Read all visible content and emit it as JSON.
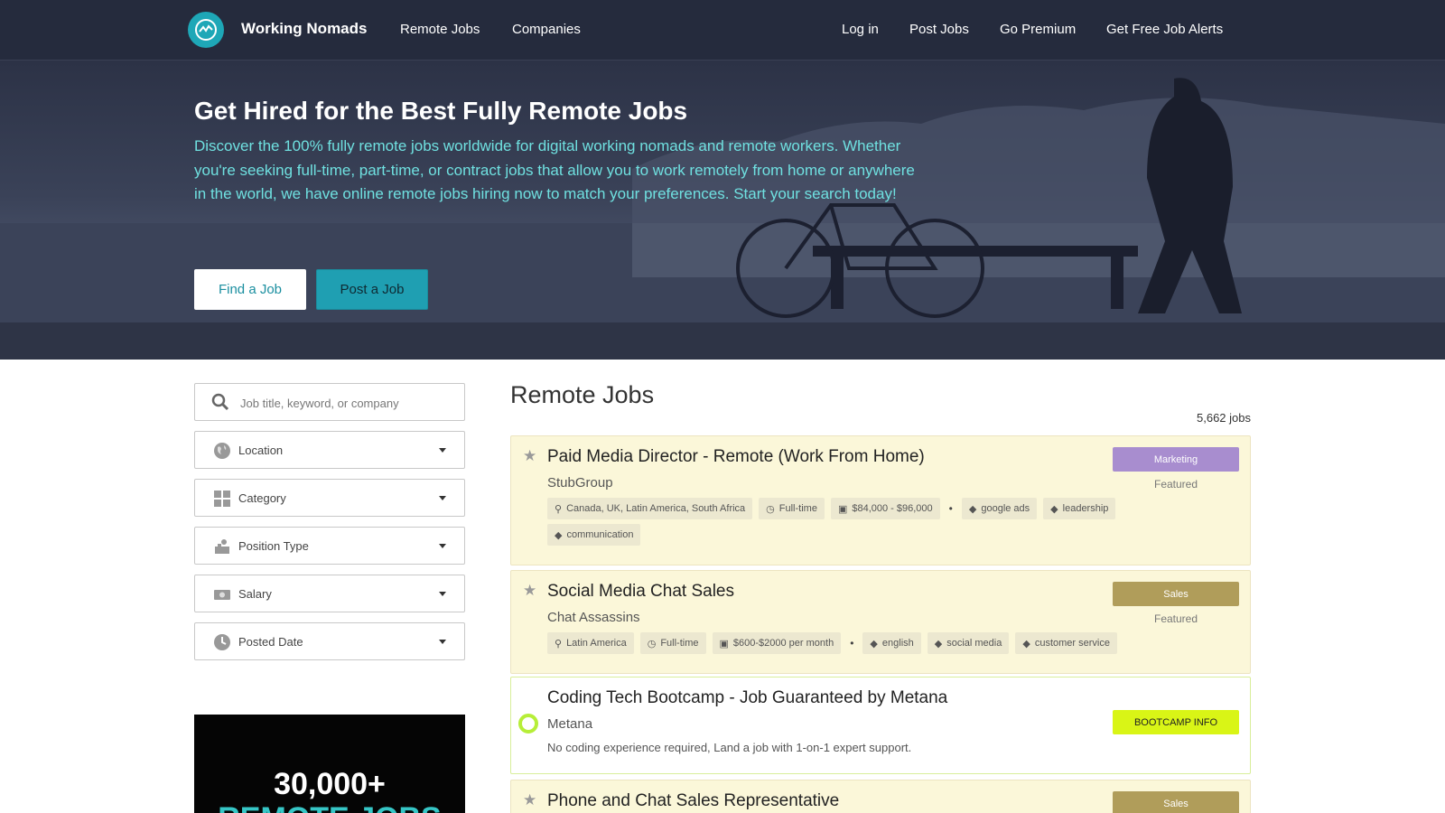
{
  "nav": {
    "brand": "Working Nomads",
    "links_left": [
      "Remote Jobs",
      "Companies"
    ],
    "links_right": [
      "Log in",
      "Post Jobs",
      "Go Premium",
      "Get Free Job Alerts"
    ]
  },
  "hero": {
    "title": "Get Hired for the Best Fully Remote Jobs",
    "description": "Discover the 100% fully remote jobs worldwide for digital working nomads and remote workers. Whether you're seeking full-time, part-time, or contract jobs that allow you to work remotely from home or anywhere in the world, we have online remote jobs hiring now to match your preferences. Start your search today!",
    "find_button": "Find a Job",
    "post_button": "Post a Job"
  },
  "sidebar": {
    "search_placeholder": "Job title, keyword, or company",
    "filters": [
      {
        "label": "Location",
        "icon": "globe-icon"
      },
      {
        "label": "Category",
        "icon": "grid-icon"
      },
      {
        "label": "Position Type",
        "icon": "worker-icon"
      },
      {
        "label": "Salary",
        "icon": "money-icon"
      },
      {
        "label": "Posted Date",
        "icon": "clock-icon"
      }
    ],
    "ad": {
      "line1": "30,000+",
      "line2": "REMOTE JOBS"
    }
  },
  "jobs": {
    "title": "Remote Jobs",
    "count": "5,662 jobs",
    "items": [
      {
        "title": "Paid Media Director - Remote (Work From Home)",
        "company": "StubGroup",
        "location": "Canada, UK, Latin America, South Africa",
        "type": "Full-time",
        "salary": "$84,000 - $96,000",
        "skills": [
          "google ads",
          "leadership",
          "communication"
        ],
        "badge": "Marketing",
        "badge_color": "#a88dcf",
        "featured": "Featured"
      },
      {
        "title": "Social Media Chat Sales",
        "company": "Chat Assassins",
        "location": "Latin America",
        "type": "Full-time",
        "salary": "$600-$2000 per month",
        "skills": [
          "english",
          "social media",
          "customer service"
        ],
        "badge": "Sales",
        "badge_color": "#b09d5a",
        "featured": "Featured"
      },
      {
        "title": "Coding Tech Bootcamp - Job Guaranteed by Metana",
        "company": "Metana",
        "description": "No coding experience required, Land a job with 1-on-1 expert support.",
        "badge": "BOOTCAMP INFO",
        "badge_color": "#d9f516"
      },
      {
        "title": "Phone and Chat Sales Representative",
        "badge": "Sales",
        "badge_color": "#b09d5a"
      }
    ]
  }
}
